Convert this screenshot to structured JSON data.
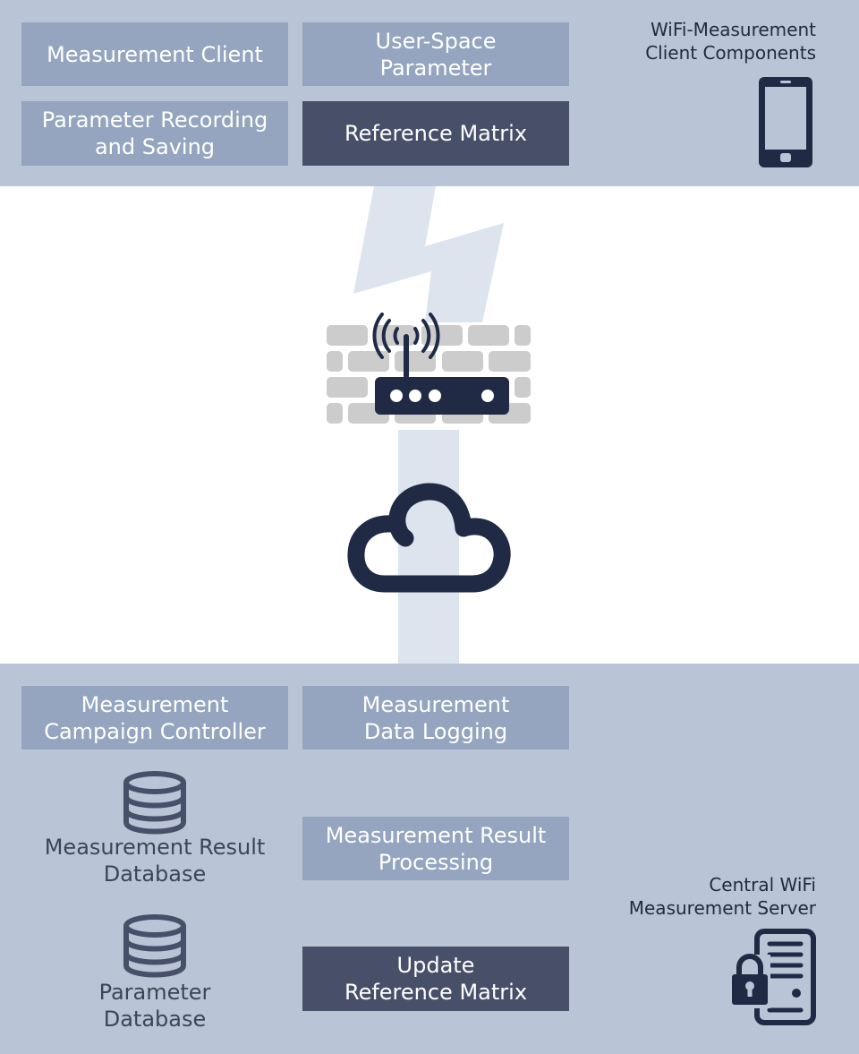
{
  "client": {
    "label": "WiFi-Measurement\nClient Components",
    "boxes": [
      "Measurement Client",
      "User-Space\nParameter",
      "Parameter Recording\nand Saving",
      "Reference Matrix"
    ],
    "icon": "smartphone-icon"
  },
  "network": {
    "icons": [
      "lightning-icon",
      "firewall-icon",
      "wifi-router-icon",
      "cloud-icon"
    ]
  },
  "server": {
    "label": "Central WiFi\nMeasurement Server",
    "boxes": [
      "Measurement\nCampaign Controller",
      "Measurement\nData Logging",
      "Measurement Result\nProcessing",
      "Update\nReference Matrix"
    ],
    "databases": [
      "Measurement Result\nDatabase",
      "Parameter\nDatabase"
    ],
    "icon": "secure-server-icon"
  },
  "colors": {
    "band": "#b9c5d7",
    "box": "#95a5bf",
    "box_dark": "#475068",
    "icon": "#212a44",
    "connector": "#dde4ed",
    "brick": "#cccccc"
  }
}
